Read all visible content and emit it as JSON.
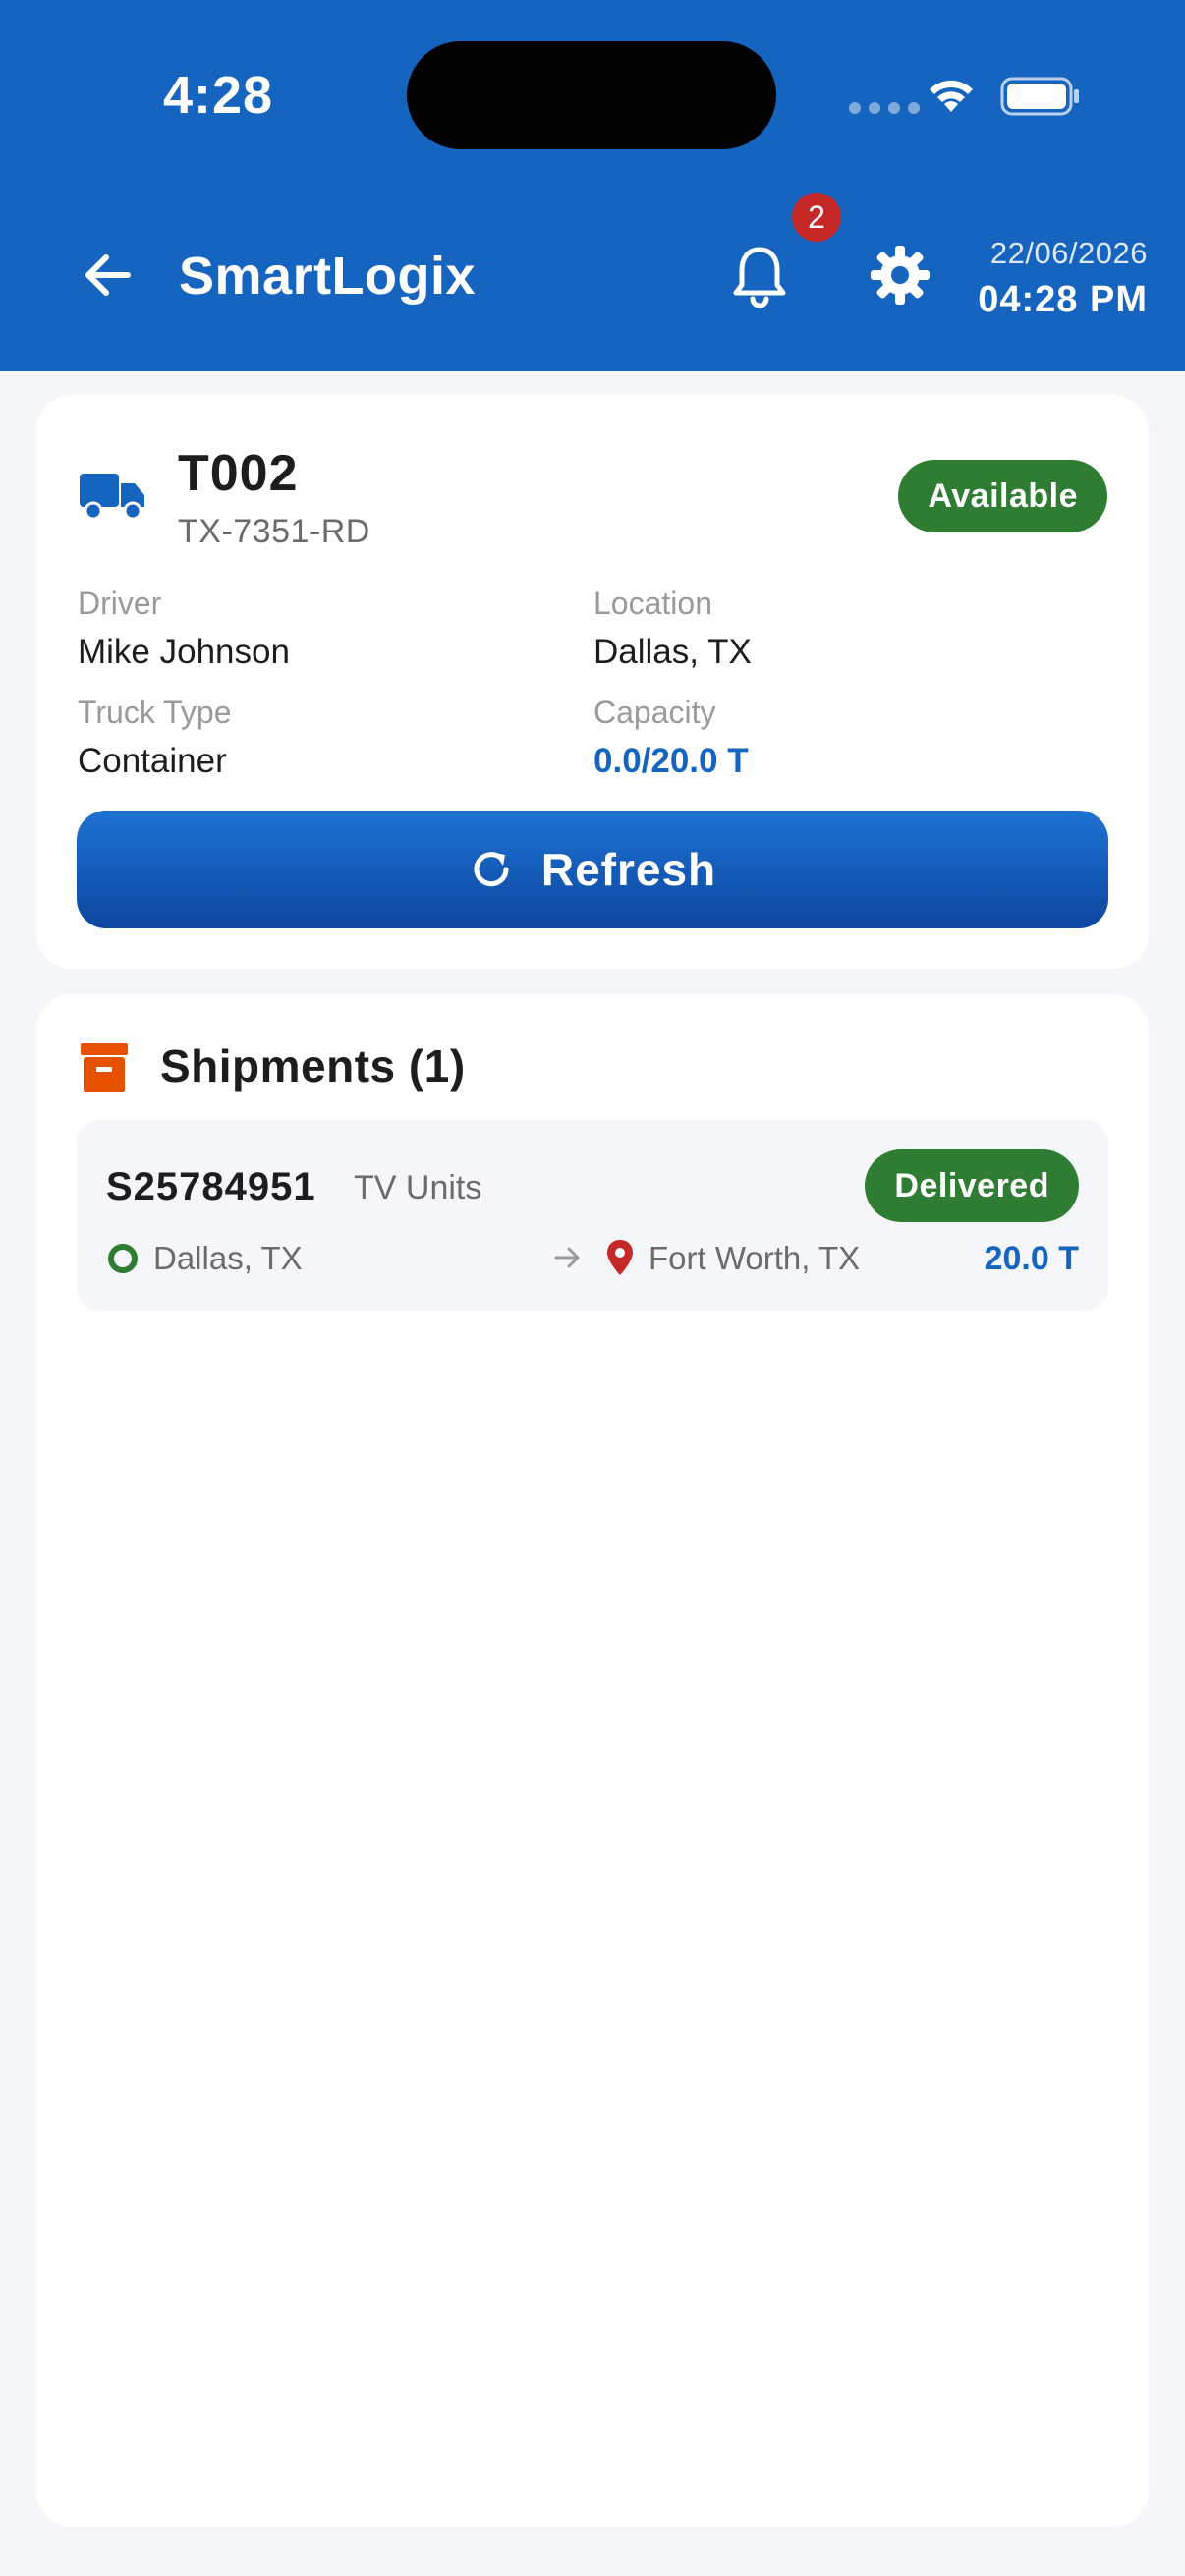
{
  "status_bar": {
    "time": "4:28"
  },
  "header": {
    "title": "SmartLogix",
    "notification_count": "2",
    "date": "22/06/2026",
    "clock": "04:28 PM",
    "icons": [
      "back-arrow-icon",
      "bell-icon",
      "gear-icon"
    ]
  },
  "truck": {
    "id": "T002",
    "plate": "TX-7351-RD",
    "status": "Available",
    "driver_label": "Driver",
    "driver": "Mike Johnson",
    "location_label": "Location",
    "location": "Dallas, TX",
    "type_label": "Truck Type",
    "type": "Container",
    "capacity_label": "Capacity",
    "capacity": "0.0/20.0 T",
    "refresh_label": "Refresh"
  },
  "shipments": {
    "title": "Shipments (1)",
    "items": [
      {
        "id": "S25784951",
        "cargo": "TV Units",
        "status": "Delivered",
        "origin": "Dallas, TX",
        "destination": "Fort Worth, TX",
        "weight": "20.0 T"
      }
    ]
  },
  "colors": {
    "primary": "#1565c0",
    "success": "#2e7d32",
    "badge": "#c62828",
    "box_icon": "#e65100",
    "destination_pin": "#c62828"
  }
}
